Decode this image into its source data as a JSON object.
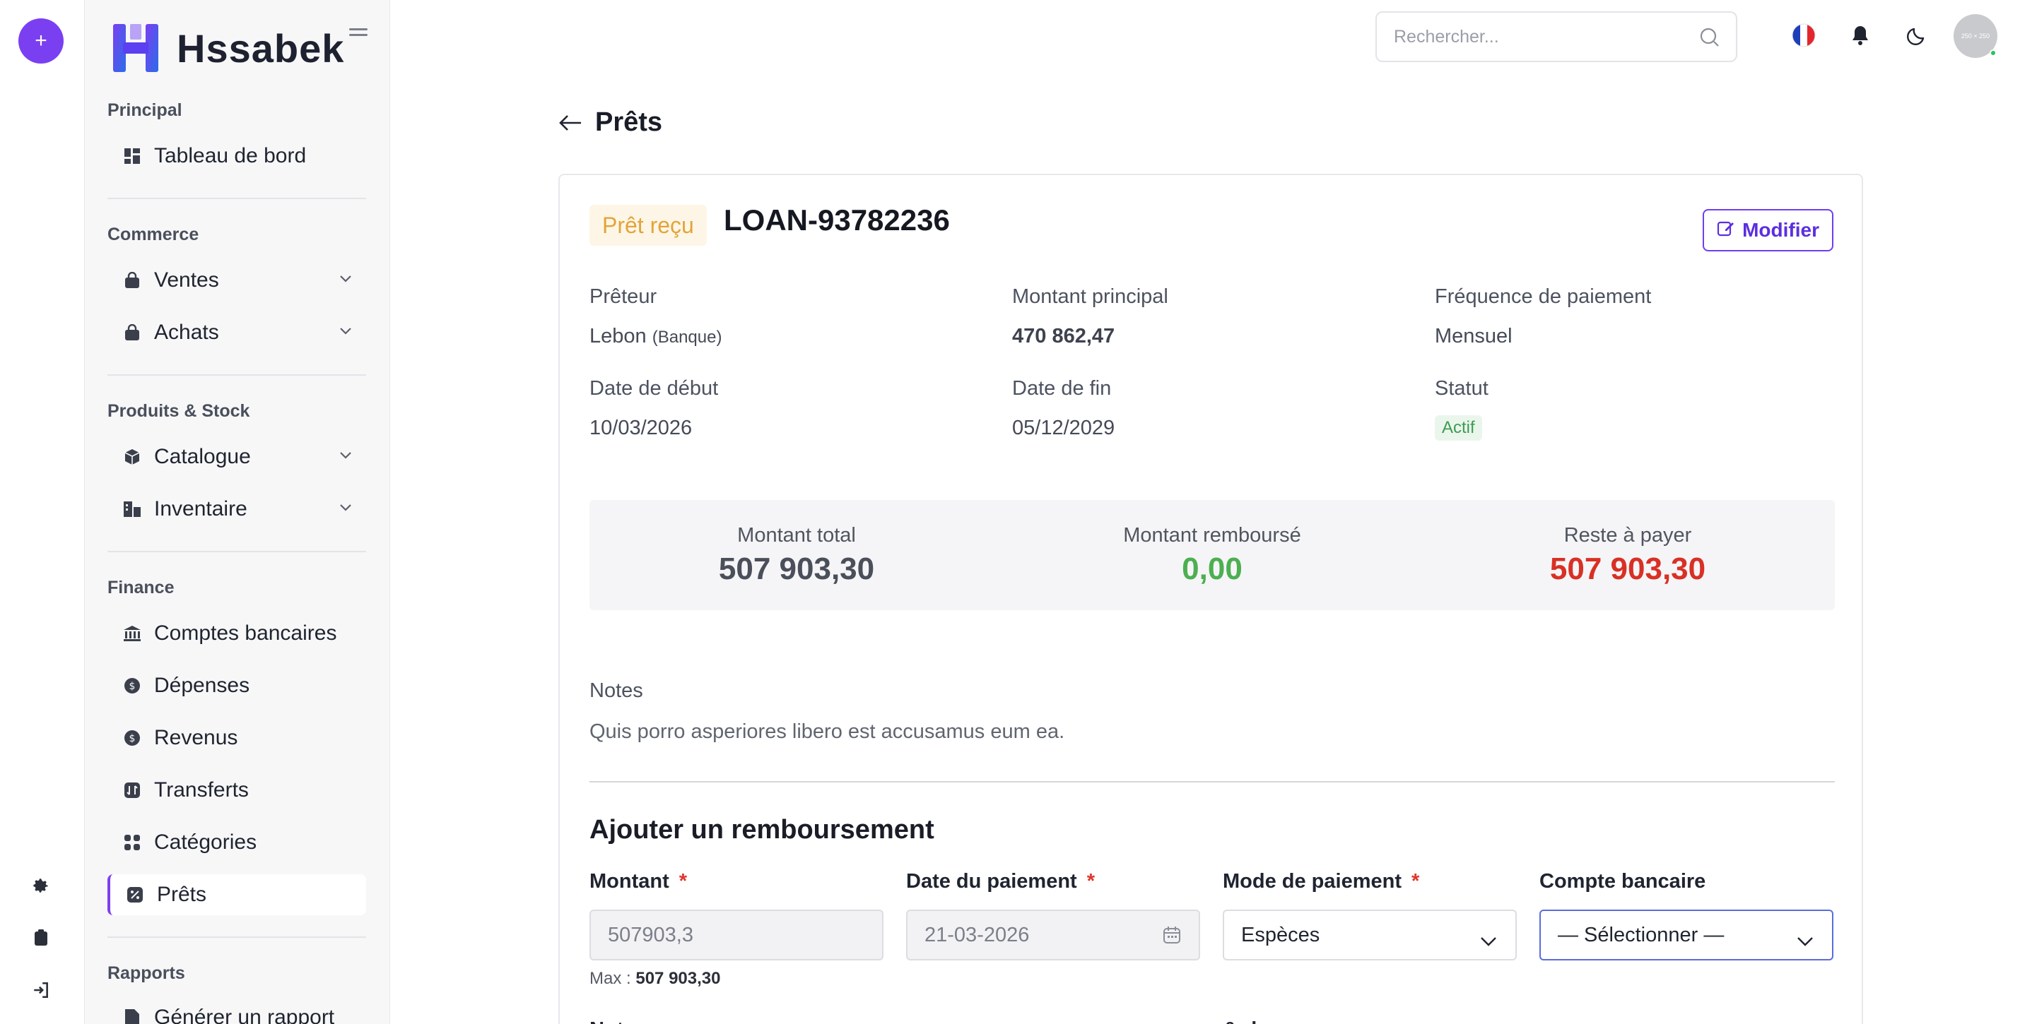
{
  "sidebar": {
    "brand": "Hssabek",
    "sections": {
      "principal": "Principal",
      "commerce": "Commerce",
      "produits": "Produits & Stock",
      "finance": "Finance",
      "rapports": "Rapports"
    },
    "items": {
      "dashboard": "Tableau de bord",
      "ventes": "Ventes",
      "achats": "Achats",
      "catalogue": "Catalogue",
      "inventaire": "Inventaire",
      "comptes": "Comptes bancaires",
      "depenses": "Dépenses",
      "revenus": "Revenus",
      "transferts": "Transferts",
      "categories": "Catégories",
      "prets": "Prêts",
      "rapport": "Générer un rapport"
    }
  },
  "topbar": {
    "search_placeholder": "Rechercher...",
    "avatar_text": "250 × 250"
  },
  "page": {
    "title": "Prêts"
  },
  "loan": {
    "type_badge": "Prêt reçu",
    "reference": "LOAN-93782236",
    "edit_label": "Modifier",
    "lender_label": "Prêteur",
    "lender_name": "Lebon",
    "lender_type": "(Banque)",
    "principal_label": "Montant principal",
    "principal_value": "470 862,47",
    "frequency_label": "Fréquence de paiement",
    "frequency_value": "Mensuel",
    "start_label": "Date de début",
    "start_value": "10/03/2026",
    "end_label": "Date de fin",
    "end_value": "05/12/2029",
    "status_label": "Statut",
    "status_value": "Actif"
  },
  "summary": {
    "total_label": "Montant total",
    "total_value": "507 903,30",
    "repaid_label": "Montant remboursé",
    "repaid_value": "0,00",
    "remaining_label": "Reste à payer",
    "remaining_value": "507 903,30"
  },
  "notes": {
    "label": "Notes",
    "text": "Quis porro asperiores libero est accusamus eum ea."
  },
  "repayment": {
    "title": "Ajouter un remboursement",
    "amount_label": "Montant",
    "amount_value": "507903,3",
    "date_label": "Date du paiement",
    "date_value": "21-03-2026",
    "method_label": "Mode de paiement",
    "method_value": "Espèces",
    "account_label": "Compte bancaire",
    "account_value": "— Sélectionner —",
    "max_prefix": "Max :",
    "max_value": "507 903,30",
    "required_mark": "*",
    "note_label_partial": "Note",
    "ref_label_partial": "& rhon:"
  },
  "colors": {
    "accent": "#7b3ff2",
    "badge_text": "#e3a43a",
    "repaid": "#4caf50",
    "remaining": "#d93025"
  }
}
